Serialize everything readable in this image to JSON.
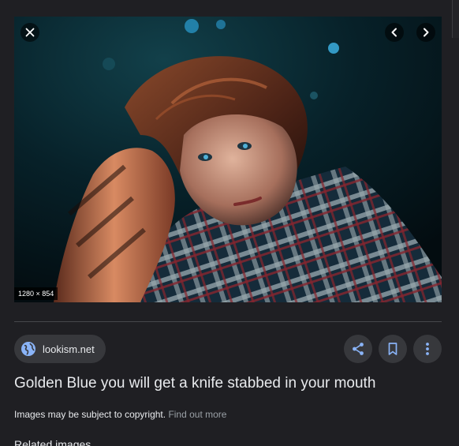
{
  "viewer": {
    "image_dimensions": "1280 × 854",
    "image_alt": "Golden Blue you will get a knife stabbed in your mouth",
    "close_icon": "close-icon",
    "prev_icon": "chevron-left-icon",
    "next_icon": "chevron-right-icon"
  },
  "source": {
    "site": "lookism.net",
    "icon": "globe-icon"
  },
  "actions": [
    {
      "name": "share",
      "icon": "share-icon"
    },
    {
      "name": "save",
      "icon": "bookmark-icon"
    },
    {
      "name": "more",
      "icon": "more-vert-icon"
    }
  ],
  "title": "Golden Blue you will get a knife stabbed in your mouth",
  "copyright": {
    "notice": "Images may be subject to copyright.",
    "link": "Find out more"
  },
  "related_heading": "Related images",
  "colors": {
    "background": "#1f1f23",
    "chip": "#37383c",
    "text": "#e8eaed",
    "muted": "#9aa0a6",
    "icon_blue": "#8ab4f8"
  }
}
